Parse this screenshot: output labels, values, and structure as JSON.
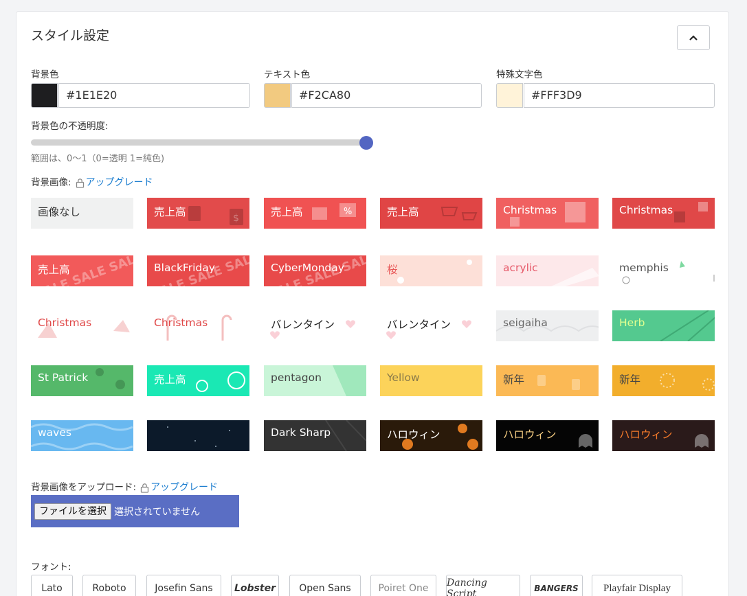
{
  "panel": {
    "title": "スタイル設定"
  },
  "colors": {
    "background": {
      "label": "背景色",
      "value": "#1E1E20",
      "swatch": "#1E1E20"
    },
    "text": {
      "label": "テキスト色",
      "value": "#F2CA80",
      "swatch": "#F2CA80"
    },
    "special": {
      "label": "特殊文字色",
      "value": "#FFF3D9",
      "swatch": "#FFF3D9"
    }
  },
  "opacity": {
    "label": "背景色の不透明度:",
    "value": 1,
    "hint": "範囲は、0〜1（0=透明 1=純色)"
  },
  "bg_image": {
    "label": "背景画像:",
    "upgrade": "アップグレード"
  },
  "tiles": [
    {
      "label": "画像なし",
      "bg": "#f0f1f1",
      "color": "#333333",
      "pattern": "none"
    },
    {
      "label": "売上高",
      "bg": "#e24b4b",
      "color": "#ffffff",
      "pattern": "bag"
    },
    {
      "label": "売上高",
      "bg": "#f05252",
      "color": "#ffffff",
      "pattern": "percent"
    },
    {
      "label": "売上高",
      "bg": "#e04545",
      "color": "#ffffff",
      "pattern": "cart"
    },
    {
      "label": "Christmas",
      "bg": "#f06060",
      "color": "#ffffff",
      "pattern": "pixel"
    },
    {
      "label": "Christmas",
      "bg": "#e04848",
      "color": "#ffffff",
      "pattern": "gift"
    },
    {
      "label": "売上高",
      "bg": "#f25a5a",
      "color": "#ffffff",
      "pattern": "sale"
    },
    {
      "label": "BlackFriday",
      "bg": "#e84a4a",
      "color": "#ffffff",
      "pattern": "sale"
    },
    {
      "label": "CyberMonday",
      "bg": "#e84a4a",
      "color": "#ffffff",
      "pattern": "sale"
    },
    {
      "label": "桜",
      "bg": "#fde0d8",
      "color": "#e85a5a",
      "pattern": "dots"
    },
    {
      "label": "acrylic",
      "bg": "#fde8ea",
      "color": "#e65a6a",
      "pattern": "stroke"
    },
    {
      "label": "memphis",
      "bg": "#ffffff",
      "color": "#555555",
      "pattern": "memphis"
    },
    {
      "label": "Christmas",
      "bg": "#ffffff",
      "color": "#e04848",
      "pattern": "hat"
    },
    {
      "label": "Christmas",
      "bg": "#ffffff",
      "color": "#e04848",
      "pattern": "candy"
    },
    {
      "label": "バレンタイン",
      "bg": "#ffffff",
      "color": "#222222",
      "pattern": "heart"
    },
    {
      "label": "バレンタイン",
      "bg": "#ffffff",
      "color": "#222222",
      "pattern": "heart"
    },
    {
      "label": "seigaiha",
      "bg": "#eeeff0",
      "color": "#666666",
      "pattern": "wave"
    },
    {
      "label": "Herb",
      "bg": "#54c98f",
      "color": "#e0ff90",
      "pattern": "leaf"
    },
    {
      "label": "St Patrick",
      "bg": "#55b86a",
      "color": "#ffffff",
      "pattern": "clover"
    },
    {
      "label": "売上高",
      "bg": "#1ae8b4",
      "color": "#ffffff",
      "pattern": "coin"
    },
    {
      "label": "pentagon",
      "bg": "#c9f5d8",
      "color": "#444444",
      "pattern": "poly"
    },
    {
      "label": "Yellow",
      "bg": "#fcd35a",
      "color": "#8a7a4a",
      "pattern": "grid"
    },
    {
      "label": "新年",
      "bg": "#fbb955",
      "color": "#444444",
      "pattern": "beer"
    },
    {
      "label": "新年",
      "bg": "#f2ae2c",
      "color": "#444444",
      "pattern": "burst"
    },
    {
      "label": "waves",
      "bg": "#68b8f0",
      "color": "#ffffff",
      "pattern": "wavy"
    },
    {
      "label": "",
      "bg": "#0c1a2a",
      "color": "#ffffff",
      "pattern": "stars"
    },
    {
      "label": "Dark Sharp",
      "bg": "#333333",
      "color": "#ffffff",
      "pattern": "dark"
    },
    {
      "label": "ハロウィン",
      "bg": "#2a1a0a",
      "color": "#ffffff",
      "pattern": "pumpkin"
    },
    {
      "label": "ハロウィン",
      "bg": "#050505",
      "color": "#f2ca80",
      "pattern": "ghost"
    },
    {
      "label": "ハロウィン",
      "bg": "#2a1a1a",
      "color": "#f47a2a",
      "pattern": "ghost"
    }
  ],
  "upload": {
    "label": "背景画像をアップロード:",
    "upgrade": "アップグレード",
    "button": "ファイルを選択",
    "status": "選択されていません"
  },
  "fonts": {
    "label": "フォント:",
    "items": [
      {
        "label": "Lato"
      },
      {
        "label": "Roboto"
      },
      {
        "label": "Josefin Sans"
      },
      {
        "label": "Lobster"
      },
      {
        "label": "Open Sans"
      },
      {
        "label": "Poiret One"
      },
      {
        "label": "Dancing Script"
      },
      {
        "label": "BANGERS"
      },
      {
        "label": "Playfair Display"
      }
    ]
  }
}
